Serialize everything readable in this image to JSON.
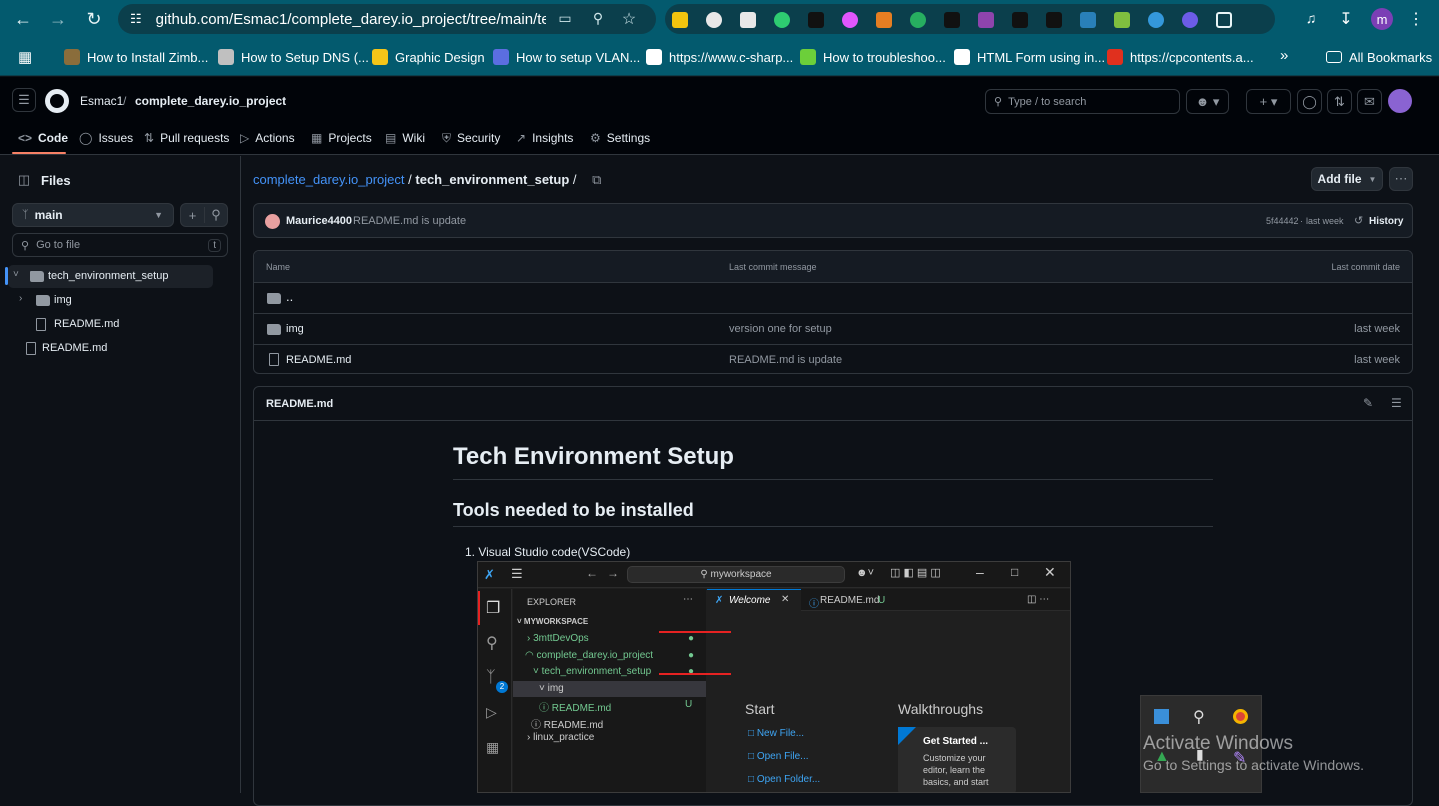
{
  "browser": {
    "url": "github.com/Esmac1/complete_darey.io_project/tree/main/te...",
    "bookmarks": [
      {
        "label": "How to Install Zimb...",
        "color": "#8a6d3b"
      },
      {
        "label": "How to Setup DNS (...",
        "color": "#c0c0c0"
      },
      {
        "label": "Graphic Design",
        "color": "#f5c518"
      },
      {
        "label": "How to setup VLAN...",
        "color": "#5b6ee1"
      },
      {
        "label": "https://www.c-sharp...",
        "color": "#ffffff"
      },
      {
        "label": "How to troubleshoo...",
        "color": "#6ccf3a"
      },
      {
        "label": "HTML Form using in...",
        "color": "#ffffff"
      },
      {
        "label": "https://cpcontents.a...",
        "color": "#e0301e"
      }
    ],
    "all_bookmarks": "All Bookmarks",
    "profile_initial": "m"
  },
  "github": {
    "owner": "Esmac1",
    "repo": "complete_darey.io_project",
    "search_placeholder": "Type / to search",
    "search_key": "/",
    "tabs": [
      {
        "label": "Code",
        "icon": "code-icon"
      },
      {
        "label": "Issues",
        "icon": "issue-icon"
      },
      {
        "label": "Pull requests",
        "icon": "pull-request-icon"
      },
      {
        "label": "Actions",
        "icon": "actions-icon"
      },
      {
        "label": "Projects",
        "icon": "projects-icon"
      },
      {
        "label": "Wiki",
        "icon": "wiki-icon"
      },
      {
        "label": "Security",
        "icon": "shield-icon"
      },
      {
        "label": "Insights",
        "icon": "insights-icon"
      },
      {
        "label": "Settings",
        "icon": "gear-icon"
      }
    ]
  },
  "sidebar": {
    "title": "Files",
    "branch": "main",
    "go_to_file": "Go to file",
    "go_to_file_key": "t",
    "tree": [
      {
        "label": "tech_environment_setup",
        "type": "folder",
        "depth": 0,
        "open": true,
        "selected": true
      },
      {
        "label": "img",
        "type": "folder",
        "depth": 1,
        "open": false
      },
      {
        "label": "README.md",
        "type": "file",
        "depth": 1
      },
      {
        "label": "README.md",
        "type": "file",
        "depth": 0
      }
    ]
  },
  "breadcrumb": {
    "repo": "complete_darey.io_project",
    "sep": "/",
    "folder": "tech_environment_setup",
    "trail": "/"
  },
  "add_file": "Add file",
  "commit": {
    "author": "Maurice4400",
    "message": "README.md is update",
    "hash": "5f44442",
    "dot": "·",
    "when": "last week",
    "history": "History"
  },
  "table": {
    "headers": {
      "name": "Name",
      "message": "Last commit message",
      "date": "Last commit date"
    },
    "parent": "..",
    "rows": [
      {
        "name": "img",
        "type": "folder",
        "message": "version one for setup",
        "date": "last week"
      },
      {
        "name": "README.md",
        "type": "file",
        "message": "README.md is update",
        "date": "last week"
      }
    ]
  },
  "readme": {
    "title": "README.md",
    "h1": "Tech Environment Setup",
    "h2": "Tools needed to be installed",
    "list": [
      "Visual Studio code(VSCode)"
    ]
  },
  "vscode": {
    "search": "myworkspace",
    "explorer": "EXPLORER",
    "workspace": "MYWORKSPACE",
    "tree": [
      "3mttDevOps",
      "complete_darey.io_project",
      "tech_environment_setup",
      "img",
      "README.md",
      "README.md",
      "linux_practice"
    ],
    "readme_status": "U",
    "tab_welcome": "Welcome",
    "tab_readme": "README.md",
    "tab_readme_status": "U",
    "start": "Start",
    "start_items": [
      "New File...",
      "Open File...",
      "Open Folder..."
    ],
    "walkthroughs": "Walkthroughs",
    "get_started": "Get Started ...",
    "get_started_desc": "Customize your editor, learn the basics, and start",
    "badge": "2"
  },
  "windows": {
    "activate": "Activate Windows",
    "activate_sub": "Go to Settings to activate Windows."
  }
}
